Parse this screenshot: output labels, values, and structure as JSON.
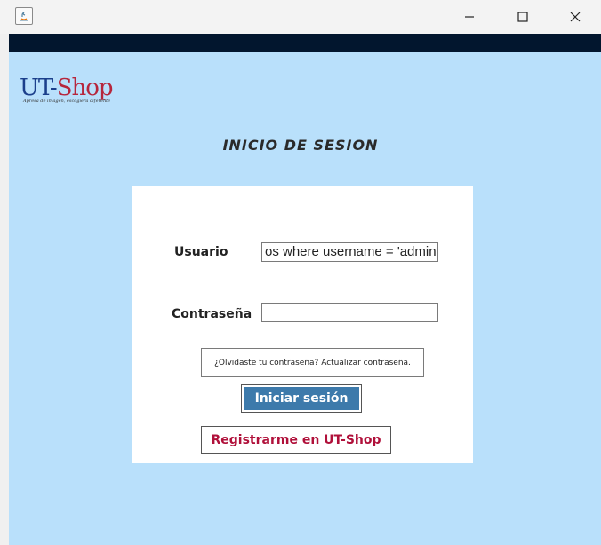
{
  "window": {
    "app_icon": "java-icon",
    "controls": {
      "minimize_icon": "minimize-icon",
      "maximize_icon": "maximize-icon",
      "close_icon": "close-icon"
    }
  },
  "logo": {
    "ut": "UT",
    "dash": "-",
    "shop": "Shop",
    "tagline": "Apresa de imagen, escogiera diferente"
  },
  "heading": "INICIO DE SESION",
  "form": {
    "username_label": "Usuario",
    "username_value": "os where username = 'admin'",
    "password_label": "Contraseña",
    "password_value": "",
    "forgot_link": "¿Olvidaste tu contraseña? Actualizar contraseña.",
    "login_button": "Iniciar sesión",
    "register_button": "Registrarme en UT-Shop"
  },
  "colors": {
    "background": "#b9e0fb",
    "topbar": "#02162e",
    "login_button": "#3d7aab",
    "register_text": "#b0103a",
    "logo_blue": "#1b3f8b",
    "logo_red": "#b6263c"
  }
}
